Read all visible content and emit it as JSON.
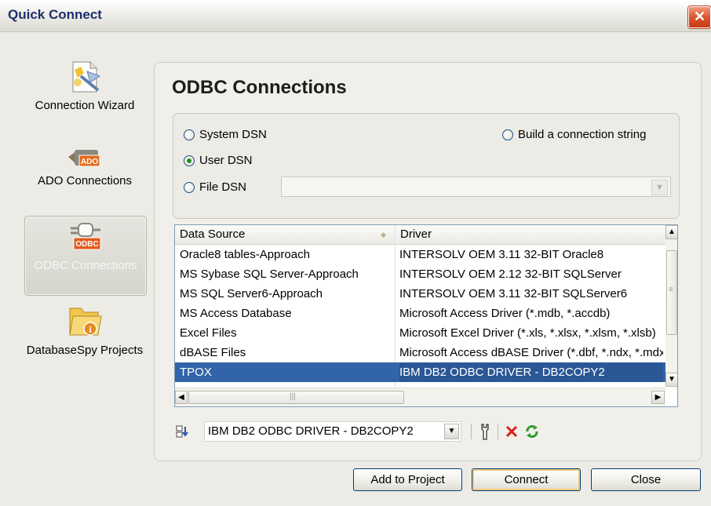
{
  "window": {
    "title": "Quick Connect"
  },
  "sidebar": {
    "items": [
      {
        "label": "Connection Wizard",
        "icon": "wizard-icon"
      },
      {
        "label": "ADO Connections",
        "icon": "ado-plug-icon",
        "badge": "ADO"
      },
      {
        "label": "ODBC Connections",
        "icon": "odbc-plug-icon",
        "badge": "ODBC",
        "selected": true
      },
      {
        "label": "DatabaseSpy Projects",
        "icon": "project-folder-icon"
      }
    ]
  },
  "panel": {
    "title": "ODBC Connections",
    "dsn_options": {
      "system": "System DSN",
      "user": "User DSN",
      "file": "File DSN",
      "build": "Build a connection string",
      "selected": "user"
    },
    "file_dsn_value": ""
  },
  "grid": {
    "columns": [
      "Data Source",
      "Driver"
    ],
    "rows": [
      {
        "source": "Oracle8 tables-Approach",
        "driver": "INTERSOLV OEM 3.11 32-BIT Oracle8"
      },
      {
        "source": "MS Sybase SQL Server-Approach",
        "driver": "INTERSOLV OEM 2.12 32-BIT SQLServer"
      },
      {
        "source": "MS SQL Server6-Approach",
        "driver": "INTERSOLV OEM 3.11 32-BIT SQLServer6"
      },
      {
        "source": "MS Access Database",
        "driver": "Microsoft Access Driver (*.mdb, *.accdb)"
      },
      {
        "source": "Excel Files",
        "driver": "Microsoft Excel Driver (*.xls, *.xlsx, *.xlsm, *.xlsb)"
      },
      {
        "source": "dBASE Files",
        "driver": "Microsoft Access dBASE Driver (*.dbf, *.ndx, *.mdx)"
      },
      {
        "source": "TPOX",
        "driver": "IBM DB2 ODBC DRIVER - DB2COPY2",
        "selected": true
      }
    ]
  },
  "toolbar": {
    "driver_value": "IBM DB2 ODBC DRIVER - DB2COPY2"
  },
  "buttons": {
    "add": "Add to Project",
    "connect": "Connect",
    "close": "Close"
  },
  "colors": {
    "selection": "#3164a9",
    "title": "#1c2f6e",
    "close_button": "#d8512b",
    "delete_icon": "#d6201a",
    "refresh_icon": "#2e9a2e"
  }
}
